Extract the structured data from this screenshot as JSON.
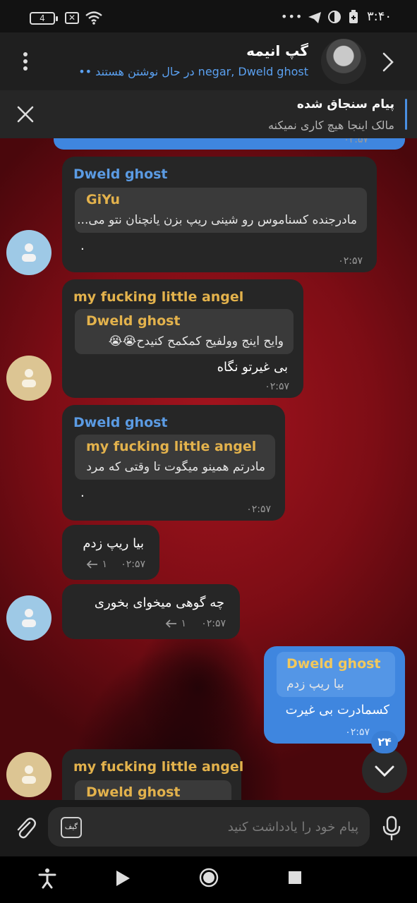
{
  "status_bar": {
    "battery_level": "4",
    "time": "۳:۴۰",
    "dots": "•••"
  },
  "header": {
    "title": "گپ انیمه",
    "status_names": "negar, Dweld ghost",
    "status_typing": "در حال نوشتن هستند",
    "typing_dots": "••"
  },
  "pinned": {
    "title": "پیام سنجاق شده",
    "text": "مالک اینجا هیچ کاری نمیکنه"
  },
  "messages": [
    {
      "sender": "Dweld ghost",
      "sender_color": "#5b9be3",
      "reply_name": "GiYu",
      "reply_name_color": "#e3b24c",
      "reply_text": "مادرجنده کسناموس رو شینی ریپ بزن یانچنان نتو می...",
      "text": ".",
      "time": "۰۲:۵۷"
    },
    {
      "sender": "my fucking little angel",
      "sender_color": "#e3b24c",
      "reply_name": "Dweld ghost",
      "reply_name_color": "#e3b24c",
      "reply_text": "وایح اینج وولفیح کمکمح کنیدح😭😭",
      "text": "بی غیرتو نگاه",
      "time": "۰۲:۵۷"
    },
    {
      "sender": "Dweld ghost",
      "sender_color": "#5b9be3",
      "reply_name": "my fucking little angel",
      "reply_name_color": "#e3b24c",
      "reply_text": "مادرتم همینو میگوت تا وقتی که مرد",
      "text": ".",
      "time": "۰۲:۵۷"
    },
    {
      "text": "بیا ریپ زدم",
      "time": "۰۲:۵۷",
      "reply_count": "۱"
    },
    {
      "text": "چه گوهی میخوای بخوری",
      "time": "۰۲:۵۷",
      "reply_count": "۱"
    },
    {
      "reply_name": "Dweld ghost",
      "reply_name_color": "#e3b24c",
      "reply_text": "بیا ریپ زدم",
      "text": "کسمادرت بی غیرت",
      "time": "۰۲:۵۷"
    },
    {
      "sender": "my fucking little angel",
      "sender_color": "#e3b24c",
      "reply_name": "Dweld ghost",
      "reply_name_color": "#e3b24c"
    }
  ],
  "top_partial_time": "۰۲:۵۷",
  "unread_badge": "۲۴",
  "input": {
    "placeholder": "پیام خود را یادداشت کنید",
    "gif_label": "گیف"
  },
  "colors": {
    "accent": "#3f86df",
    "bubble_in": "#262626",
    "blue_name": "#5b9be3",
    "gold_name": "#e3b24c"
  }
}
